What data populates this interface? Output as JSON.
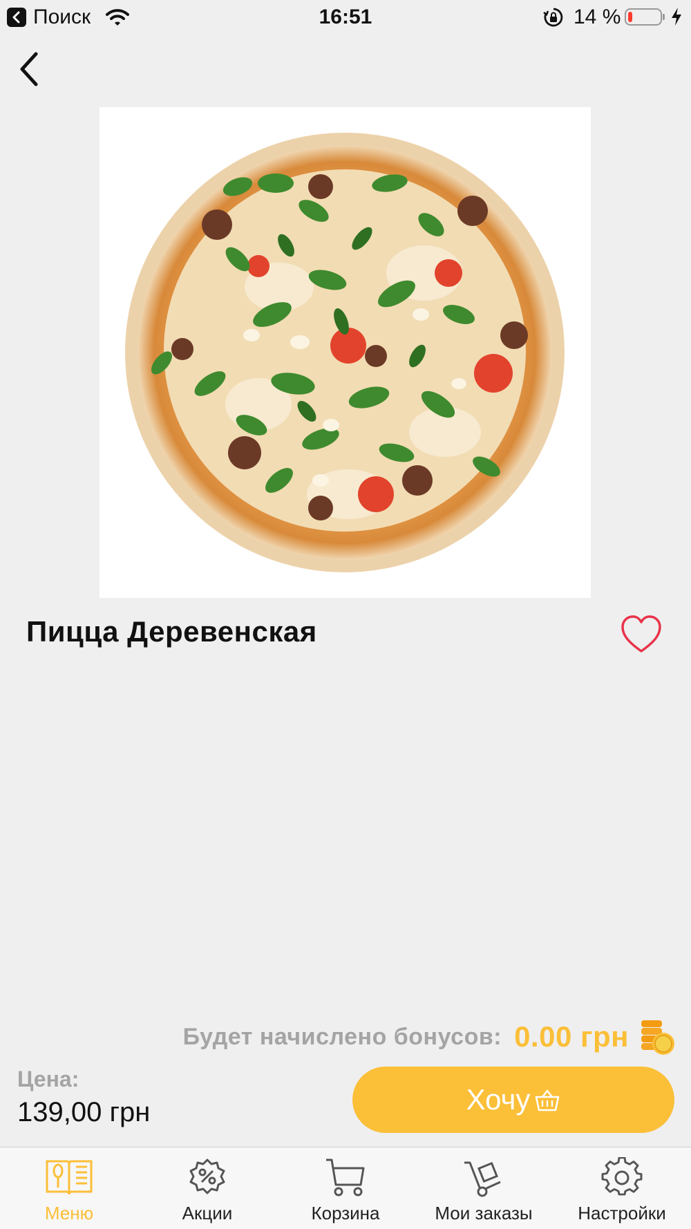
{
  "status_bar": {
    "carrier": "Поиск",
    "time": "16:51",
    "battery_text": "14 %",
    "battery_level": 0.14
  },
  "product": {
    "title": "Пицца Деревенская",
    "image_alt": "pizza-photo"
  },
  "bonus": {
    "label": "Будет начислено бонусов:",
    "value": "0.00 грн"
  },
  "price": {
    "label": "Цена:",
    "value": "139,00 грн"
  },
  "cta": {
    "label": "Хочу"
  },
  "tabs": [
    {
      "label": "Меню",
      "icon": "menu-book-icon",
      "active": true
    },
    {
      "label": "Акции",
      "icon": "percent-gear-icon",
      "active": false
    },
    {
      "label": "Корзина",
      "icon": "cart-icon",
      "active": false
    },
    {
      "label": "Мои заказы",
      "icon": "hand-truck-icon",
      "active": false
    },
    {
      "label": "Настройки",
      "icon": "gear-icon",
      "active": false
    }
  ],
  "colors": {
    "accent": "#fbbf38",
    "background": "#efefef",
    "favorite": "#e8334a",
    "muted_text": "#a4a4a4"
  }
}
